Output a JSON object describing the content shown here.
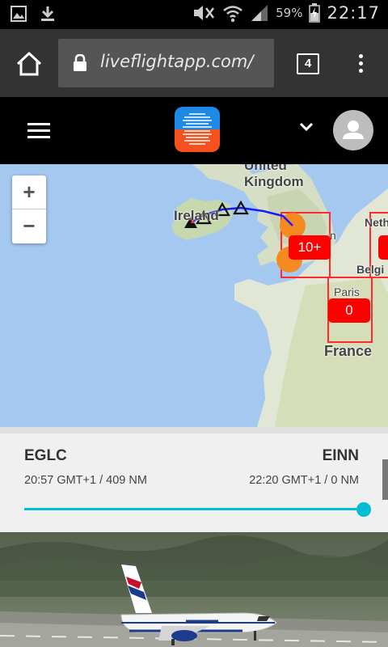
{
  "status_bar": {
    "battery": "59%",
    "time": "22:17"
  },
  "browser": {
    "url": "liveflightapp.com/",
    "tab_count": "4"
  },
  "app": {
    "logo_colors": {
      "top": "#1e88e5",
      "bottom": "#f4511e"
    }
  },
  "map": {
    "zoom_in": "+",
    "zoom_out": "−",
    "labels": {
      "united_kingdom": "United\nKingdom",
      "ireland": "Ireland",
      "paris": "Paris",
      "france": "France",
      "netherlands": "Neth",
      "belgium": "Belgi",
      "london": "n"
    },
    "clusters": [
      {
        "label": "10+"
      },
      {
        "label": "0"
      }
    ],
    "route_color": "#1a1aff"
  },
  "flight": {
    "origin_code": "EGLC",
    "origin_info": "20:57 GMT+1 / 409 NM",
    "dest_code": "EINN",
    "dest_info": "22:20 GMT+1 / 0 NM",
    "progress": 1.0,
    "accent_color": "#00bcd4"
  }
}
